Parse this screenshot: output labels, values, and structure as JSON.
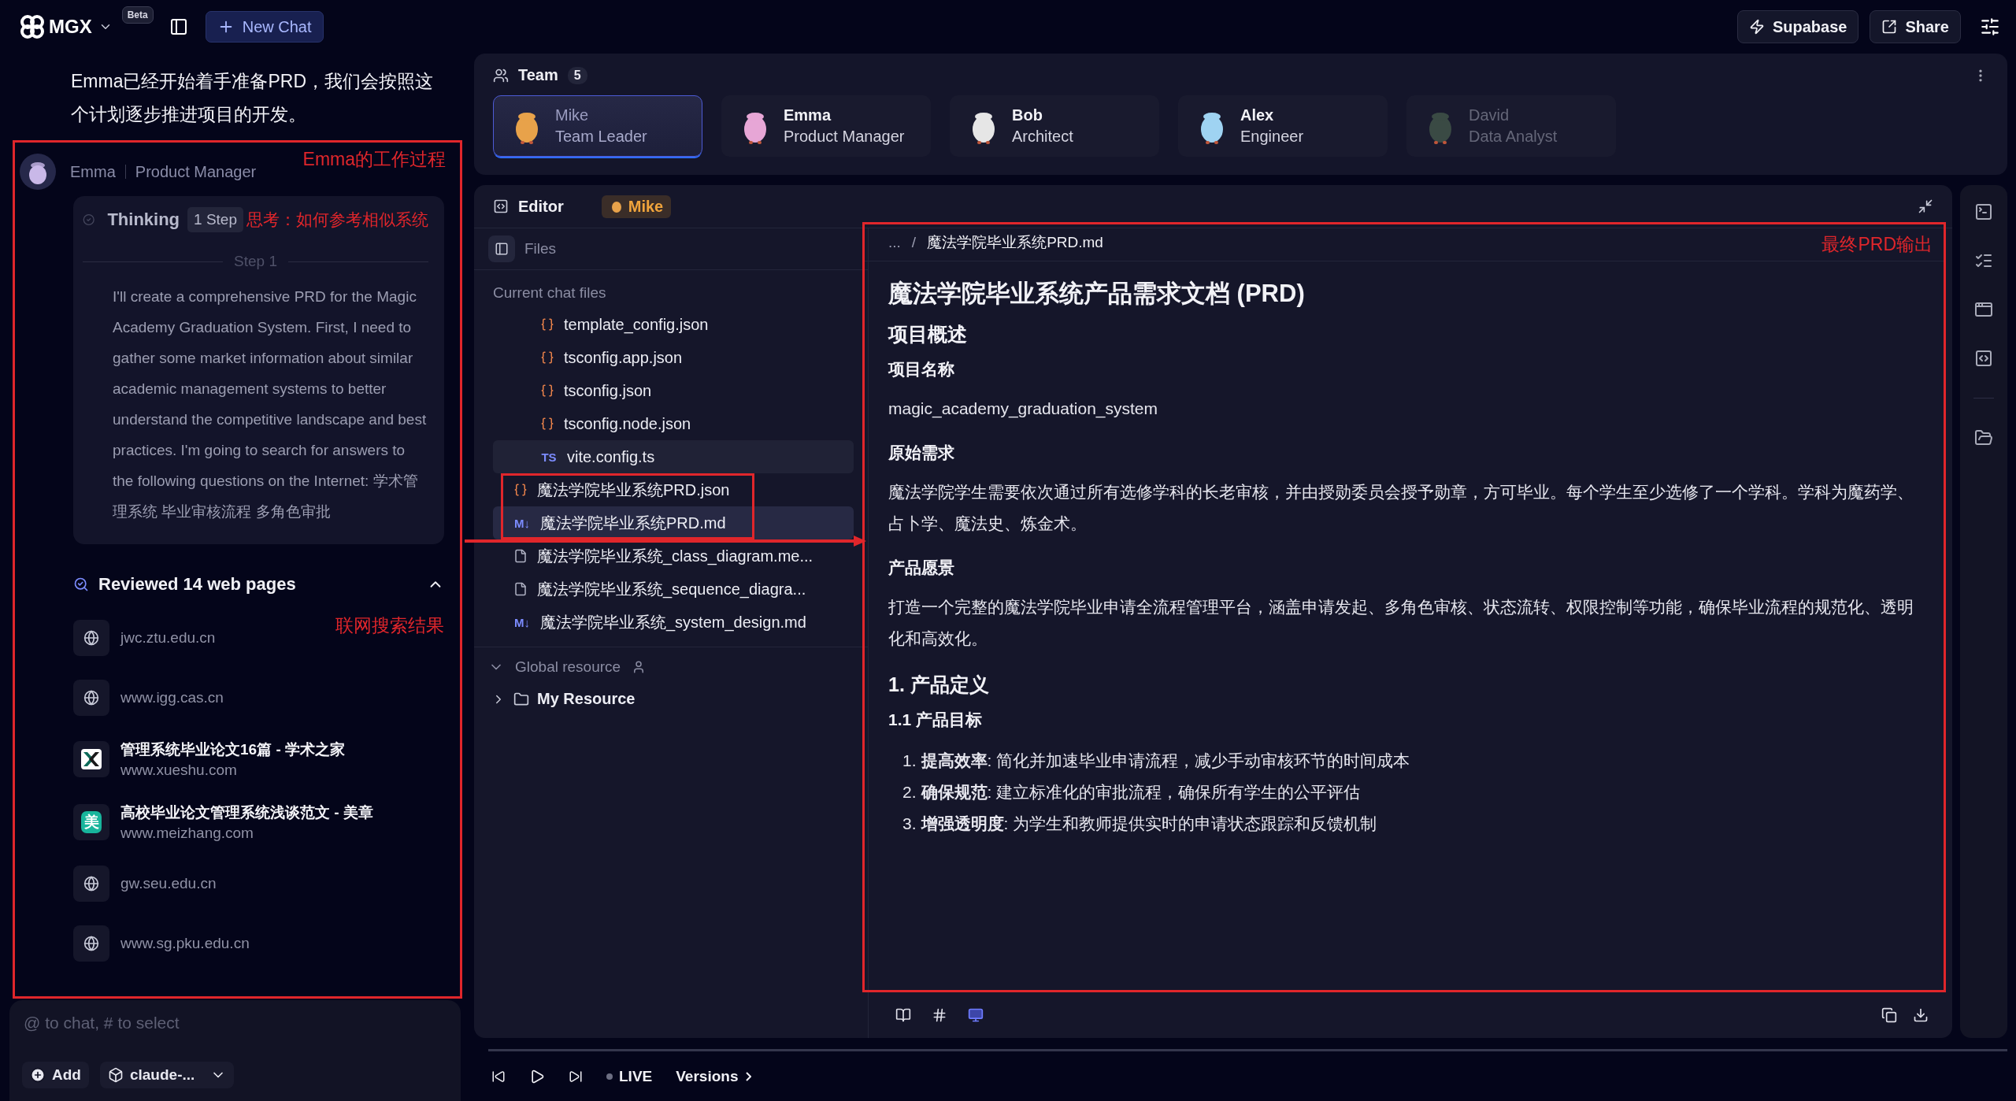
{
  "topbar": {
    "logo": "MGX",
    "badge": "Beta",
    "new_chat": "New Chat",
    "actions": [
      {
        "kind": "supabase",
        "label": "Supabase"
      },
      {
        "kind": "share",
        "label": "Share"
      }
    ]
  },
  "chat": {
    "message": "Emma已经开始着手准备PRD，我们会按照这个计划逐步推进项目的开发。",
    "agent": {
      "name": "Emma",
      "role": "Product Manager",
      "color": "#c9b8e8",
      "annotation": "Emma的工作过程"
    },
    "thinking": {
      "label": "Thinking",
      "badge": "1 Step",
      "annotation": "思考：如何参考相似系统",
      "step": "Step 1",
      "text": "I'll create a comprehensive PRD for the Magic Academy Graduation System. First, I need to gather some market information about similar academic management systems to better understand the competitive landscape and best practices. I'm going to search for answers to the following questions on the Internet: 学术管理系统 毕业审核流程 多角色审批"
    },
    "reviewed": {
      "title": "Reviewed 14 web pages",
      "expanded": true,
      "annotation": "联网搜索结果",
      "sources": [
        {
          "kind": "globe",
          "domain": "jwc.ztu.edu.cn"
        },
        {
          "kind": "globe",
          "domain": "www.igg.cas.cn"
        },
        {
          "kind": "xueshu",
          "title": "管理系统毕业论文16篇 - 学术之家",
          "domain": "www.xueshu.com"
        },
        {
          "kind": "meizhang",
          "badge": "美",
          "title": "高校毕业论文管理系统浅谈范文 - 美章",
          "domain": "www.meizhang.com"
        },
        {
          "kind": "globe",
          "domain": "gw.seu.edu.cn"
        },
        {
          "kind": "globe",
          "domain": "www.sg.pku.edu.cn"
        }
      ]
    },
    "input": {
      "placeholder": "@ to chat, # to select",
      "add": "Add",
      "model": "claude-..."
    }
  },
  "team": {
    "title": "Team",
    "count": "5",
    "members": [
      {
        "name": "Mike",
        "role": "Team Leader",
        "selected": true,
        "disabled": false,
        "color": "#e8a24a"
      },
      {
        "name": "Emma",
        "role": "Product Manager",
        "selected": false,
        "disabled": false,
        "color": "#e7a6d6"
      },
      {
        "name": "Bob",
        "role": "Architect",
        "selected": false,
        "disabled": false,
        "color": "#e6e6e6"
      },
      {
        "name": "Alex",
        "role": "Engineer",
        "selected": false,
        "disabled": false,
        "color": "#9fd3f2"
      },
      {
        "name": "David",
        "role": "Data Analyst",
        "selected": false,
        "disabled": true,
        "color": "#3a4a44"
      }
    ]
  },
  "editor": {
    "title": "Editor",
    "owner": "Mike",
    "files": {
      "title": "Files",
      "section": "Current chat files",
      "nested": [
        {
          "name": "template_config.json",
          "kind": "json",
          "selected": false,
          "hovered": false,
          "highlighted": false
        },
        {
          "name": "tsconfig.app.json",
          "kind": "json",
          "selected": false,
          "hovered": false,
          "highlighted": false
        },
        {
          "name": "tsconfig.json",
          "kind": "json",
          "selected": false,
          "hovered": false,
          "highlighted": false
        },
        {
          "name": "tsconfig.node.json",
          "kind": "json",
          "selected": false,
          "hovered": false,
          "highlighted": false
        },
        {
          "name": "vite.config.ts",
          "kind": "badge",
          "badge": "TS",
          "selected": false,
          "hovered": true,
          "highlighted": false
        }
      ],
      "items": [
        {
          "name": "魔法学院毕业系统PRD.json",
          "kind": "json",
          "selected": false,
          "hovered": false,
          "highlighted": true
        },
        {
          "name": "魔法学院毕业系统PRD.md",
          "kind": "badge",
          "badge": "M↓",
          "selected": true,
          "hovered": false,
          "highlighted": true
        },
        {
          "name": "魔法学院毕业系统_class_diagram.me...",
          "kind": "file",
          "selected": false,
          "hovered": false,
          "highlighted": false
        },
        {
          "name": "魔法学院毕业系统_sequence_diagra...",
          "kind": "file",
          "selected": false,
          "hovered": false,
          "highlighted": false
        },
        {
          "name": "魔法学院毕业系统_system_design.md",
          "kind": "badge",
          "badge": "M↓",
          "selected": false,
          "hovered": false,
          "highlighted": false
        }
      ],
      "global": {
        "title": "Global resource",
        "expanded": true,
        "folders": [
          {
            "name": "My Resource",
            "expanded": false
          }
        ]
      }
    },
    "document": {
      "path": [
        "...",
        "/",
        "魔法学院毕业系统PRD.md"
      ],
      "annotation": "最终PRD输出",
      "blocks": [
        {
          "kind": "h1",
          "text": "魔法学院毕业系统产品需求文档 (PRD)"
        },
        {
          "kind": "h2",
          "text": "项目概述"
        },
        {
          "kind": "h3",
          "text": "项目名称"
        },
        {
          "kind": "p",
          "text": "magic_academy_graduation_system"
        },
        {
          "kind": "h3",
          "text": "原始需求"
        },
        {
          "kind": "p",
          "text": "魔法学院学生需要依次通过所有选修学科的长老审核，并由授勋委员会授予勋章，方可毕业。每个学生至少选修了一个学科。学科为魔药学、占卜学、魔法史、炼金术。"
        },
        {
          "kind": "h3",
          "text": "产品愿景"
        },
        {
          "kind": "p",
          "text": "打造一个完整的魔法学院毕业申请全流程管理平台，涵盖申请发起、多角色审核、状态流转、权限控制等功能，确保毕业流程的规范化、透明化和高效化。"
        },
        {
          "kind": "h2",
          "text": "1. 产品定义"
        },
        {
          "kind": "h3",
          "text": "1.1 产品目标"
        },
        {
          "kind": "ol",
          "items": [
            {
              "number": "1.",
              "text": "**提高效率**: 简化并加速毕业申请流程，减少手动审核环节的时间成本"
            },
            {
              "number": "2.",
              "text": "**确保规范**: 建立标准化的审批流程，确保所有学生的公平评估"
            },
            {
              "number": "3.",
              "text": "**增强透明度**: 为学生和教师提供实时的申请状态跟踪和反馈机制"
            }
          ]
        }
      ]
    },
    "view_modes": [
      {
        "kind": "book",
        "selected": false
      },
      {
        "kind": "hash",
        "selected": false
      },
      {
        "kind": "preview",
        "selected": true
      }
    ]
  },
  "playback": {
    "live": "LIVE",
    "versions": "Versions"
  }
}
